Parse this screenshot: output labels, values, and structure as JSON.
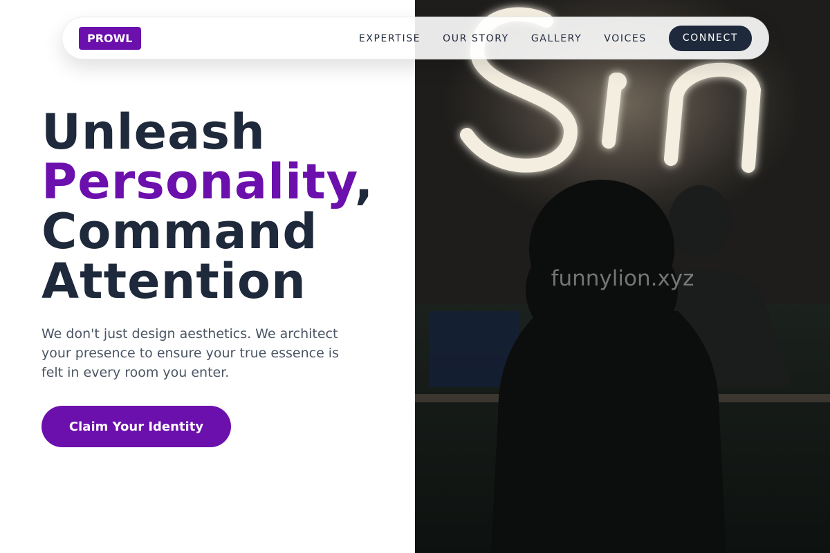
{
  "nav": {
    "logo": "PROWL",
    "links": [
      "EXPERTISE",
      "OUR STORY",
      "GALLERY",
      "VOICES"
    ],
    "cta": "CONNECT"
  },
  "hero": {
    "line1": "Unleash",
    "line2_accent": "Personality",
    "line2_punct": ",",
    "line3": "Command",
    "line4": "Attention",
    "subtitle": "We don't just design aesthetics. We architect your presence to ensure your true essence is felt in every room you enter.",
    "cta": "Claim Your Identity"
  },
  "image": {
    "neon_text": "Sin",
    "watermark": "funnylion.xyz"
  },
  "colors": {
    "accent": "#6b0fad",
    "dark": "#1e293b",
    "body_text": "#4b5563"
  }
}
